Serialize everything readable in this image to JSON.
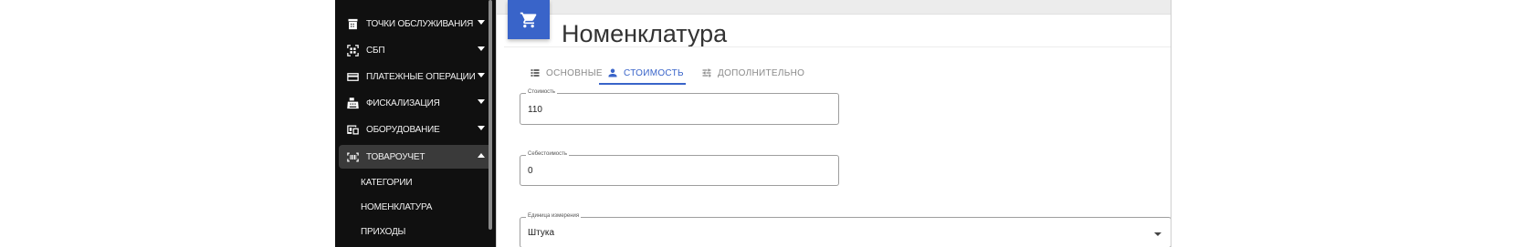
{
  "sidebar": {
    "items": [
      {
        "label": "ТОЧКИ ОБСЛУЖИВАНИЯ",
        "icon": "store-icon",
        "expanded": false
      },
      {
        "label": "СБП",
        "icon": "qr-scan-icon",
        "expanded": false
      },
      {
        "label": "ПЛАТЕЖНЫЕ ОПЕРАЦИИ",
        "icon": "credit-card-icon",
        "expanded": false
      },
      {
        "label": "ФИСКАЛИЗАЦИЯ",
        "icon": "cash-register-icon",
        "expanded": false
      },
      {
        "label": "ОБОРУДОВАНИЕ",
        "icon": "devices-icon",
        "expanded": false
      },
      {
        "label": "ТОВАРОУЧЕТ",
        "icon": "barcode-icon",
        "expanded": true
      }
    ],
    "subitems": [
      {
        "label": "КАТЕГОРИИ"
      },
      {
        "label": "НОМЕНКЛАТУРА"
      },
      {
        "label": "ПРИХОДЫ"
      }
    ]
  },
  "header": {
    "icon": "cart-icon",
    "title": "Номенклатура",
    "accent_color": "#3964c9"
  },
  "tabs": [
    {
      "label": "ОСНОВНЫЕ",
      "icon": "list-icon",
      "active": false
    },
    {
      "label": "СТОИМОСТЬ",
      "icon": "person-icon",
      "active": true
    },
    {
      "label": "ДОПОЛНИТЕЛЬНО",
      "icon": "tune-icon",
      "active": false
    }
  ],
  "form": {
    "price": {
      "label": "Стоимость",
      "value": "110"
    },
    "cost": {
      "label": "Себестоимость",
      "value": "0"
    },
    "unit": {
      "label": "Единица измерения",
      "value": "Штука"
    }
  }
}
